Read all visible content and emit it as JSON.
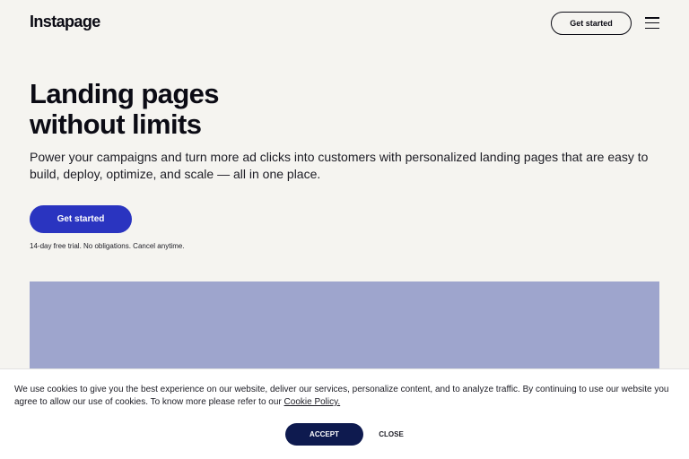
{
  "header": {
    "logo": "Instapage",
    "cta_label": "Get started",
    "menu_icon": "hamburger-menu-icon"
  },
  "hero": {
    "title_line1": "Landing pages",
    "title_line2": "without limits",
    "subtitle": "Power your campaigns and turn more ad clicks into customers with personalized landing pages that are easy to build, deploy, optimize, and scale — all in one place.",
    "cta_label": "Get started",
    "trial_note": "14-day free trial. No obligations. Cancel anytime."
  },
  "cookie_banner": {
    "text": "We use cookies to give you the best experience on our website, deliver our services, personalize content, and to analyze traffic. By continuing to use our website you agree to allow our use of cookies. To know more please refer to our ",
    "link_text": "Cookie Policy.",
    "accept_label": "ACCEPT",
    "close_label": "CLOSE"
  },
  "colors": {
    "background": "#f5f4f0",
    "primary_button": "#2a34c0",
    "accept_button": "#0e1a4f",
    "media_placeholder": "#9ea5cd"
  }
}
